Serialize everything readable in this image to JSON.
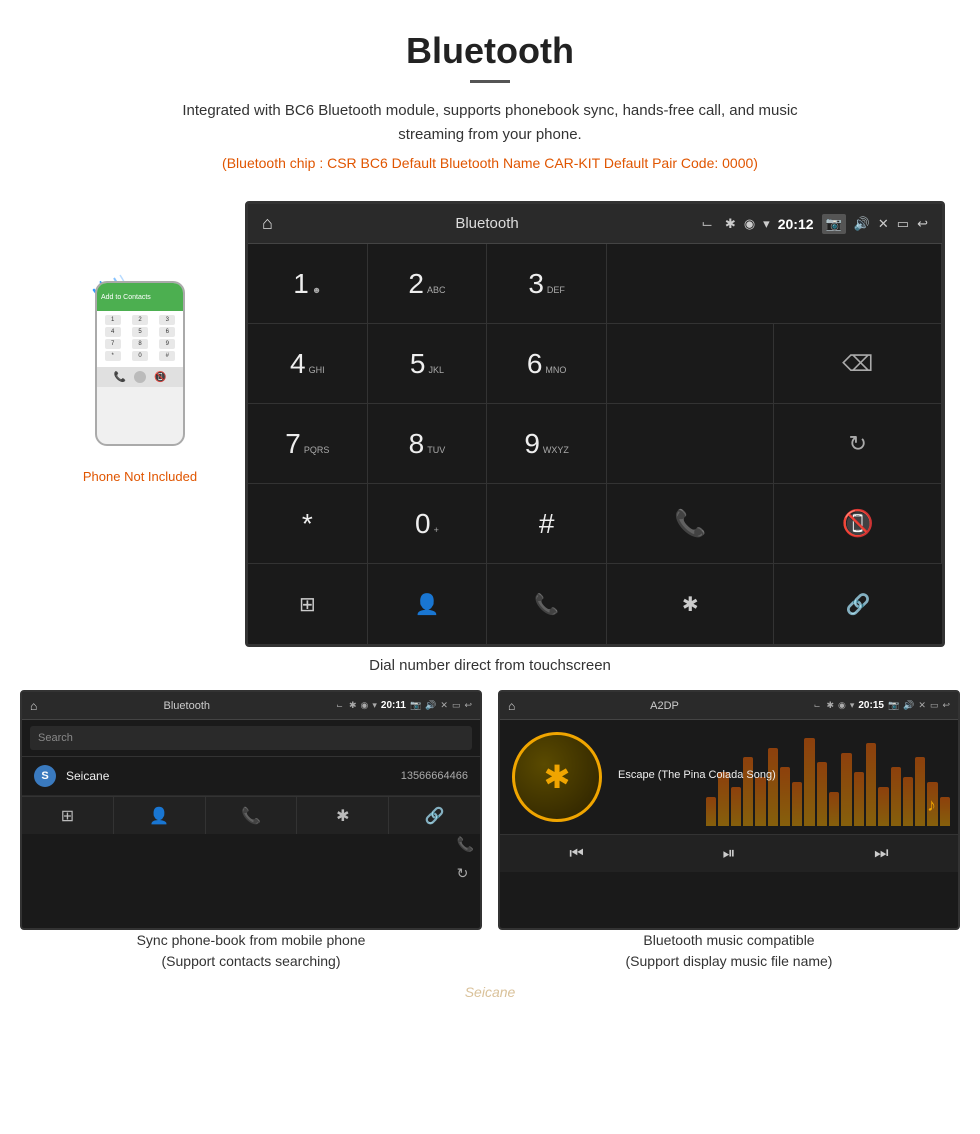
{
  "header": {
    "title": "Bluetooth",
    "description": "Integrated with BC6 Bluetooth module, supports phonebook sync, hands-free call, and music streaming from your phone.",
    "specs": "(Bluetooth chip : CSR BC6    Default Bluetooth Name CAR-KIT     Default Pair Code: 0000)"
  },
  "main_screen": {
    "topbar": {
      "title": "Bluetooth",
      "time": "20:12",
      "usb_icon": "⌸",
      "bt_icon": "⌸"
    },
    "dialpad": {
      "keys": [
        {
          "num": "1",
          "sub": "☻"
        },
        {
          "num": "2",
          "sub": "ABC"
        },
        {
          "num": "3",
          "sub": "DEF"
        },
        {
          "num": "",
          "sub": ""
        },
        {
          "num": "⌫",
          "sub": ""
        },
        {
          "num": "4",
          "sub": "GHI"
        },
        {
          "num": "5",
          "sub": "JKL"
        },
        {
          "num": "6",
          "sub": "MNO"
        },
        {
          "num": "",
          "sub": ""
        },
        {
          "num": "",
          "sub": ""
        },
        {
          "num": "7",
          "sub": "PQRS"
        },
        {
          "num": "8",
          "sub": "TUV"
        },
        {
          "num": "9",
          "sub": "WXYZ"
        },
        {
          "num": "",
          "sub": ""
        },
        {
          "num": "↻",
          "sub": ""
        },
        {
          "num": "*",
          "sub": ""
        },
        {
          "num": "0",
          "sub": "+"
        },
        {
          "num": "#",
          "sub": ""
        },
        {
          "num": "📞",
          "sub": ""
        },
        {
          "num": "📵",
          "sub": ""
        }
      ],
      "nav": [
        "⊞",
        "👤",
        "📞",
        "✱",
        "🔗"
      ]
    },
    "caption": "Dial number direct from touchscreen"
  },
  "phone_aside": {
    "not_included": "Phone Not Included"
  },
  "bottom_left": {
    "topbar_title": "Bluetooth",
    "topbar_time": "20:11",
    "search_placeholder": "Search",
    "contact": {
      "letter": "S",
      "name": "Seicane",
      "number": "13566664466"
    },
    "caption_line1": "Sync phone-book from mobile phone",
    "caption_line2": "(Support contacts searching)"
  },
  "bottom_right": {
    "topbar_title": "A2DP",
    "topbar_time": "20:15",
    "song_title": "Escape (The Pina Colada Song)",
    "caption_line1": "Bluetooth music compatible",
    "caption_line2": "(Support display music file name)"
  },
  "watermark": "Seicane",
  "colors": {
    "orange": "#e05500",
    "green": "#4caf50",
    "red": "#f44336",
    "bt_blue": "#3399ff",
    "gold": "#f0a500"
  }
}
